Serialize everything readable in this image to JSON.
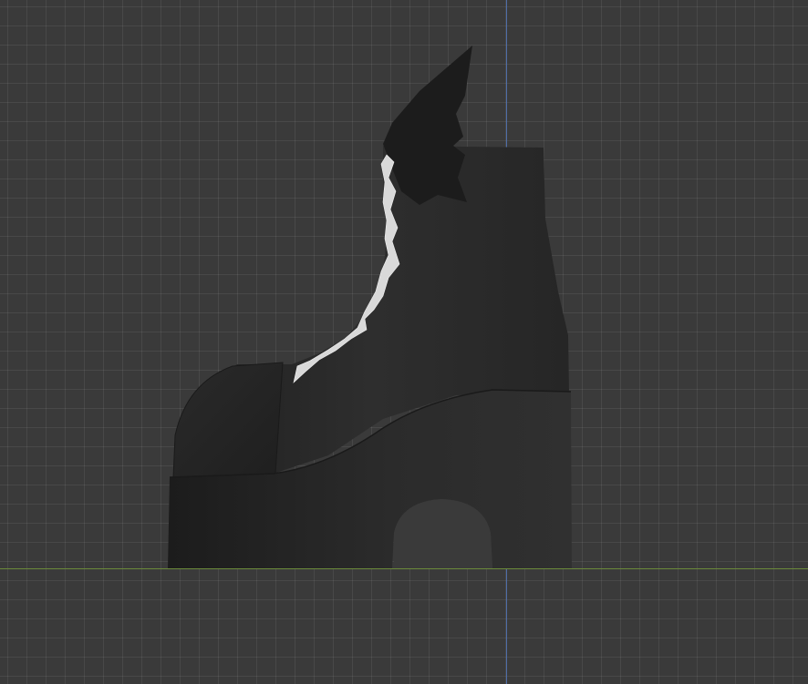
{
  "viewport": {
    "background_color": "#3a3a3a",
    "grid_color": "#4a4a4a",
    "axis_y_color": "#4f6ea8",
    "axis_x_color": "#6b8a3a"
  },
  "model": {
    "object": "boot-model",
    "body_color": "#2a2a2a",
    "sole_color": "#262626",
    "wing_color": "#1c1c1c",
    "lace_color": "#d8d8d8"
  }
}
